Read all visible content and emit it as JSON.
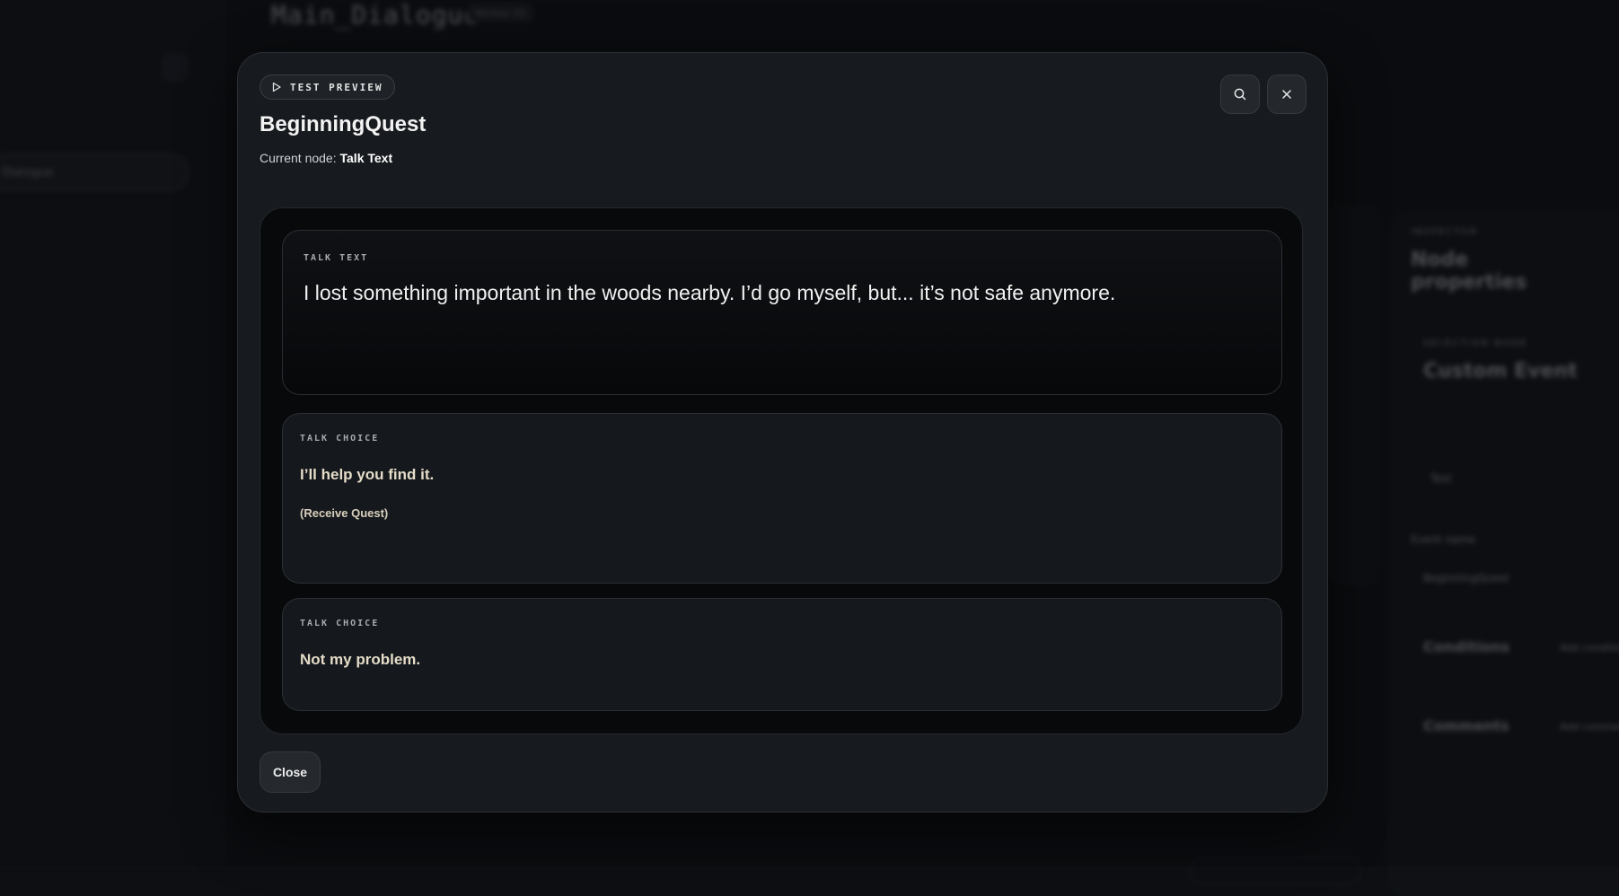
{
  "background": {
    "document_title": "Main_Dialogue",
    "version_badge": "Version 01",
    "sidebar_item": "Dialogue",
    "inspector": {
      "section_label": "INSPECTOR",
      "title": "Node properties",
      "selection_label": "SELECTION NODE",
      "selection_title": "Custom Event",
      "test_button": "Test",
      "event_name_label": "Event name",
      "event_name_value": "BeginningQuest",
      "conditions_label": "Conditions",
      "add_condition_label": "Add condition",
      "comments_label": "Comments",
      "add_comment_label": "Add comment"
    }
  },
  "modal": {
    "badge_label": "TEST PREVIEW",
    "title": "BeginningQuest",
    "current_node_prefix": "Current node:",
    "current_node_value": "Talk Text",
    "search_icon": "search-icon",
    "close_icon": "close-icon",
    "talk_text": {
      "label": "TALK TEXT",
      "text": "I lost something important in the woods nearby. I’d go myself, but... it’s not safe anymore."
    },
    "choices": [
      {
        "label": "TALK CHOICE",
        "text": "I’ll help you find it.",
        "sub": "(Receive Quest)"
      },
      {
        "label": "TALK CHOICE",
        "text": "Not my problem.",
        "sub": ""
      }
    ],
    "close_button": "Close"
  },
  "colors": {
    "modal_bg": "#171a1e",
    "stage_bg": "#08090b",
    "choice_text": "#e4dcc8"
  }
}
